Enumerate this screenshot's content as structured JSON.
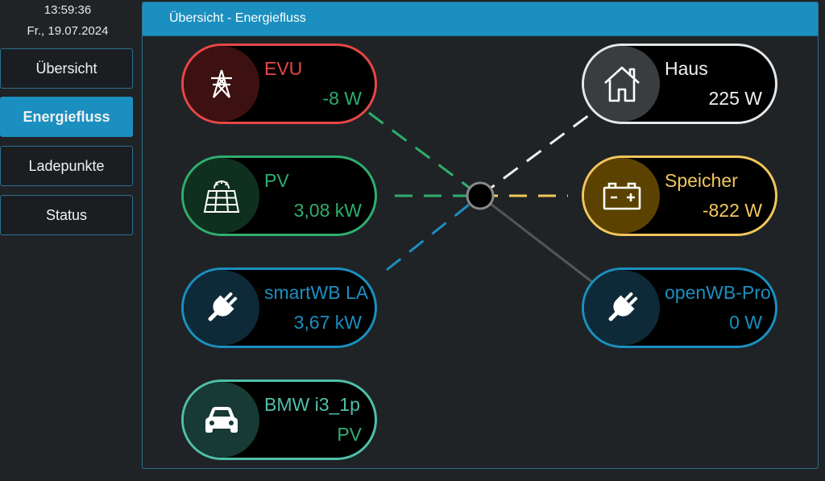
{
  "sidebar": {
    "time": "13:59:36",
    "date": "Fr., 19.07.2024",
    "nav": [
      {
        "label": "Übersicht"
      },
      {
        "label": "Energiefluss"
      },
      {
        "label": "Ladepunkte"
      },
      {
        "label": "Status"
      }
    ]
  },
  "panel": {
    "title": "Übersicht - Energiefluss"
  },
  "nodes": {
    "evu": {
      "name": "EVU",
      "value": "-8 W",
      "icon": "power-tower-icon"
    },
    "pv": {
      "name": "PV",
      "value": "3,08 kW",
      "icon": "solar-panel-icon"
    },
    "charger1": {
      "name": "smartWB LA",
      "value": "3,67 kW",
      "icon": "plug-icon"
    },
    "car": {
      "name": "BMW i3_1p",
      "value": "PV",
      "icon": "car-icon"
    },
    "house": {
      "name": "Haus",
      "value": "225 W",
      "icon": "house-icon"
    },
    "battery": {
      "name": "Speicher",
      "value": "-822 W",
      "icon": "battery-icon"
    },
    "charger2": {
      "name": "openWB-Pro",
      "value": "0 W",
      "icon": "plug-icon"
    }
  },
  "colors": {
    "accent": "#1b8fbf",
    "evu": "#e84646",
    "pv": "#2fae6e",
    "charger": "#1b8fbf",
    "car": "#4fbfa8",
    "house": "#e6e6e6",
    "battery": "#f2c65c"
  }
}
